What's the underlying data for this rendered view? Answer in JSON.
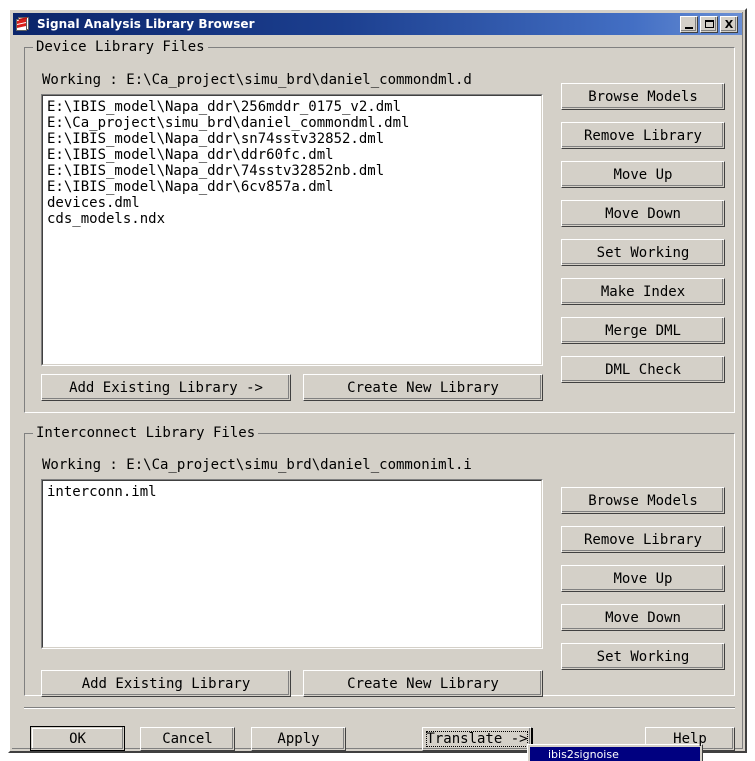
{
  "window": {
    "title": "Signal Analysis Library Browser",
    "icon": "library-document-icon",
    "controls": {
      "minimize": "_",
      "maximize": "□",
      "close": "X"
    }
  },
  "device_section": {
    "legend": "Device Library Files",
    "working_label": "Working : E:\\Ca_project\\simu_brd\\daniel_commondml.d",
    "files": [
      "E:\\IBIS_model\\Napa_ddr\\256mddr_0175_v2.dml",
      "E:\\Ca_project\\simu_brd\\daniel_commondml.dml",
      "E:\\IBIS_model\\Napa_ddr\\sn74sstv32852.dml",
      "E:\\IBIS_model\\Napa_ddr\\ddr60fc.dml",
      "E:\\IBIS_model\\Napa_ddr\\74sstv32852nb.dml",
      "E:\\IBIS_model\\Napa_ddr\\6cv857a.dml",
      "devices.dml",
      "cds_models.ndx"
    ],
    "side_buttons": [
      "Browse Models",
      "Remove Library",
      "Move Up",
      "Move Down",
      "Set Working",
      "Make Index",
      "Merge DML",
      "DML Check"
    ],
    "add_existing_label": "Add Existing Library ->",
    "create_new_label": "Create New Library"
  },
  "interconnect_section": {
    "legend": "Interconnect Library Files",
    "working_label": "Working : E:\\Ca_project\\simu_brd\\daniel_commoniml.i",
    "files": [
      "interconn.iml"
    ],
    "side_buttons": [
      "Browse Models",
      "Remove Library",
      "Move Up",
      "Move Down",
      "Set Working"
    ],
    "add_existing_label": "Add Existing Library",
    "create_new_label": "Create New Library"
  },
  "footer": {
    "ok_label": "OK",
    "cancel_label": "Cancel",
    "apply_label": "Apply",
    "translate_label": "Translate ->",
    "help_label": "Help"
  },
  "popup_menu": {
    "items": [
      "ibis2signoise"
    ]
  },
  "colors": {
    "face": "#d4d0c8",
    "title_start": "#0a246a",
    "title_end": "#6a8fd4",
    "highlight": "#000080",
    "text": "#000000",
    "listbox_bg": "#ffffff"
  }
}
